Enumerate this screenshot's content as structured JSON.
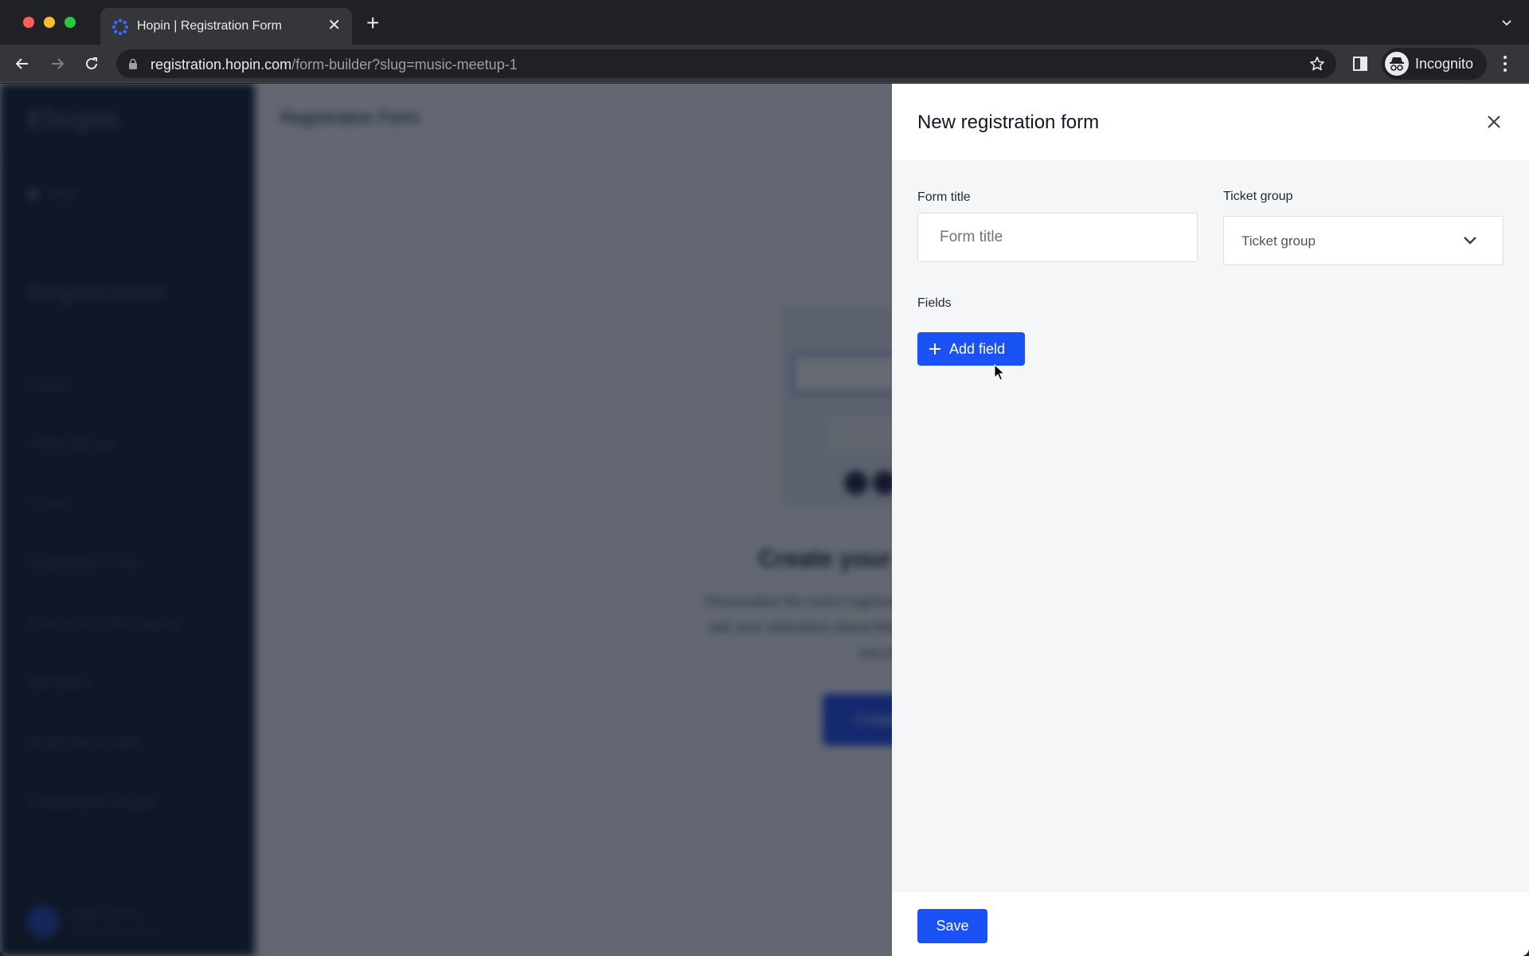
{
  "browser": {
    "tab_title": "Hopin | Registration Form",
    "url_host": "registration.hopin.com",
    "url_path": "/form-builder?slug=music-meetup-1",
    "profile_label": "Incognito",
    "icons": {
      "back": "arrow-left-icon",
      "forward": "arrow-right-icon",
      "reload": "reload-icon",
      "lock": "lock-icon",
      "bookmark": "star-icon",
      "side_panel": "side-panel-icon",
      "incognito": "incognito-icon",
      "menu": "kebab-menu-icon",
      "new_tab": "plus-icon",
      "tab_search": "chevron-down-icon"
    }
  },
  "sidebar": {
    "logo": "Ehopin",
    "back_label": "Back",
    "section_title": "Registration",
    "items": [
      {
        "label": "Details"
      },
      {
        "label": "Ticket Groups"
      },
      {
        "label": "Tickets"
      },
      {
        "label": "Registration Form"
      },
      {
        "label": "Sharing and Messaging"
      },
      {
        "label": "Attendees"
      },
      {
        "label": "Registration page"
      },
      {
        "label": "Embeddable Widget"
      }
    ],
    "user": {
      "name": "Sarah Jones",
      "subtitle": "Organization Admin"
    }
  },
  "main": {
    "page_title": "Registration Form",
    "empty_state": {
      "heading": "Create your registration form",
      "body": "Personalize the event registration form for each ticket group. You can ask your attendees about their ticket holders, and get details to help you plan your event.",
      "cta_label": "Create a custom form"
    }
  },
  "drawer": {
    "title": "New registration form",
    "form_title": {
      "label": "Form title",
      "placeholder": "Form title",
      "value": ""
    },
    "ticket_group": {
      "label": "Ticket group",
      "selected": "Ticket group"
    },
    "fields_label": "Fields",
    "add_field_label": "Add field",
    "save_label": "Save"
  },
  "colors": {
    "primary": "#1a52f5",
    "sidebar_bg": "#0f172a",
    "drawer_bg": "#f5f6f8"
  }
}
